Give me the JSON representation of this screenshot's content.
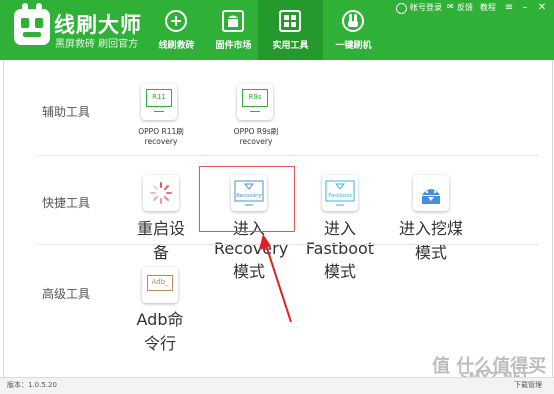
{
  "app": {
    "title": "线刷大师",
    "subtitle": "黑屏救砖 刷回官方"
  },
  "nav": [
    {
      "label": "线刷救砖",
      "icon": "plus-circle-icon",
      "active": false
    },
    {
      "label": "固件市场",
      "icon": "android-icon",
      "active": false
    },
    {
      "label": "实用工具",
      "icon": "grid-icon",
      "active": true
    },
    {
      "label": "一键刷机",
      "icon": "rabbit-icon",
      "active": false
    }
  ],
  "topbar": {
    "login": "帐号登录",
    "feedback": "反馈",
    "tutorial": "教程"
  },
  "sections": [
    {
      "label": "辅助工具",
      "tools": [
        {
          "name": "OPPO R11刷recovery",
          "screen": "R11",
          "icon": "monitor-icon"
        },
        {
          "name": "OPPO R9s刷recovery",
          "screen": "R9s",
          "icon": "monitor-icon"
        }
      ]
    },
    {
      "label": "快捷工具",
      "tools": [
        {
          "name": "重启设备",
          "icon": "restart-spinner-icon"
        },
        {
          "name": "进入Recovery模式",
          "screen": "Recovery",
          "icon": "recovery-monitor-icon"
        },
        {
          "name": "进入Fastboot模式",
          "screen": "Fastboot",
          "icon": "fastboot-monitor-icon"
        },
        {
          "name": "进入挖煤模式",
          "icon": "android-download-icon"
        }
      ]
    },
    {
      "label": "高级工具",
      "tools": [
        {
          "name": "Adb命令行",
          "screen": "Adb_",
          "icon": "adb-terminal-icon"
        }
      ]
    }
  ],
  "footer": {
    "version": "版本：1.0.5.20",
    "download_manager": "下载管理"
  },
  "watermark": {
    "line1": "值 什么值得买",
    "line2": "SMYZ.NET"
  },
  "colors": {
    "brand_green": "#2fb037",
    "active_tab": "#239a2b",
    "highlight_red": "#e25555",
    "accent_blue": "#4a8fd6",
    "accent_teal": "#3db7d6"
  }
}
